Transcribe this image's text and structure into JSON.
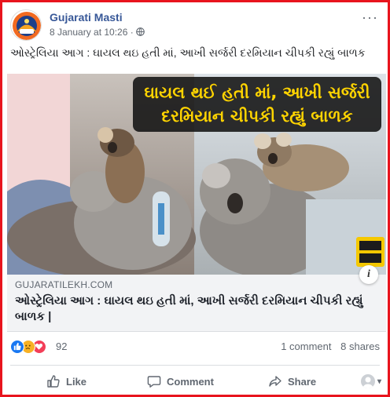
{
  "post": {
    "page_name": "Gujarati Masti",
    "date": "8 January at 10:26",
    "separator": "·",
    "more": "···",
    "text": "ઓસ્ટ્રેલિયા આગ : ઘાયલ થઇ હતી માં, આખી સર્જરી દરમિયાન ચીપકી રહ્યું બાળક"
  },
  "image": {
    "banner_line1": "ઘાયલ થઈ હતી માં, આખી સર્જરી",
    "banner_line2": "દરમિયાન ચીપકી રહ્યું બાળક"
  },
  "link": {
    "domain": "GUJARATILEKH.COM",
    "title": "ઓસ્ટ્રેલિયા આગ : ઘાયલ થઇ હતી માં, આખી સર્જરી દરમિયાન ચીપકી રહ્યું બાળક |",
    "info": "i"
  },
  "reactions": {
    "types": [
      "like-icon",
      "sad-icon",
      "love-icon"
    ],
    "count": "92",
    "comments": "1 comment",
    "shares": "8 shares"
  },
  "actions": {
    "like": "Like",
    "comment": "Comment",
    "share": "Share",
    "caret": "▾"
  },
  "colors": {
    "frame": "#e8141d",
    "link_blue": "#385898",
    "like_blue": "#1877f2",
    "banner_yellow": "#ffd400"
  }
}
